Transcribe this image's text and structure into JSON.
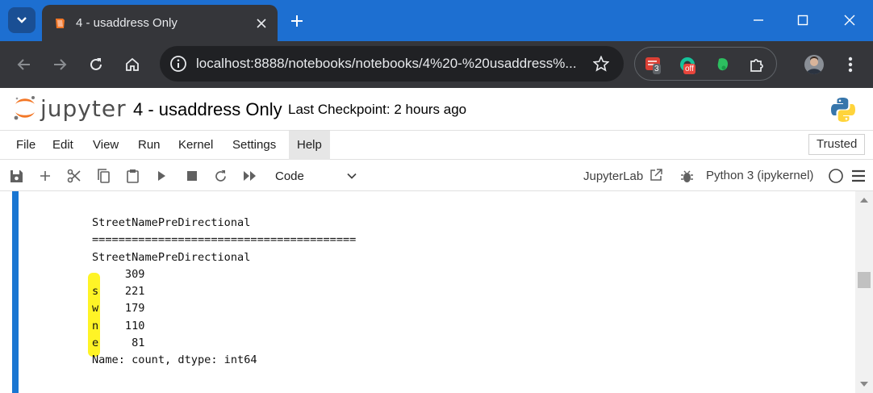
{
  "browser": {
    "tab_title": "4 - usaddress Only",
    "url": "localhost:8888/notebooks/notebooks/4%20-%20usaddress%...",
    "extensions": [
      {
        "name": "todoist-extension",
        "badge": "3"
      },
      {
        "name": "grammar-extension",
        "badge": "off"
      },
      {
        "name": "evernote-extension",
        "badge": ""
      },
      {
        "name": "puzzle-extensions",
        "badge": ""
      }
    ],
    "colors": {
      "tabstrip": "#1d6fd1",
      "toolbar": "#35363a",
      "omnibox": "#202124"
    }
  },
  "jupyter": {
    "logo_text": "jupyter",
    "notebook_title": "4 - usaddress Only",
    "checkpoint": "Last Checkpoint: 2 hours ago",
    "menu": {
      "items": [
        "File",
        "Edit",
        "View",
        "Run",
        "Kernel",
        "Settings",
        "Help"
      ],
      "trusted": "Trusted"
    },
    "toolbar": {
      "cell_type": "Code",
      "jupyterlab_link": "JupyterLab",
      "kernel": "Python 3 (ipykernel)"
    }
  },
  "output": {
    "lines": [
      "StreetNamePreDirectional",
      "========================================",
      "StreetNamePreDirectional",
      "     309",
      "s    221",
      "w    179",
      "n    110",
      "e     81",
      "Name: count, dtype: int64"
    ],
    "highlight_color": "#fff200",
    "accent_color": "#1976d2"
  }
}
